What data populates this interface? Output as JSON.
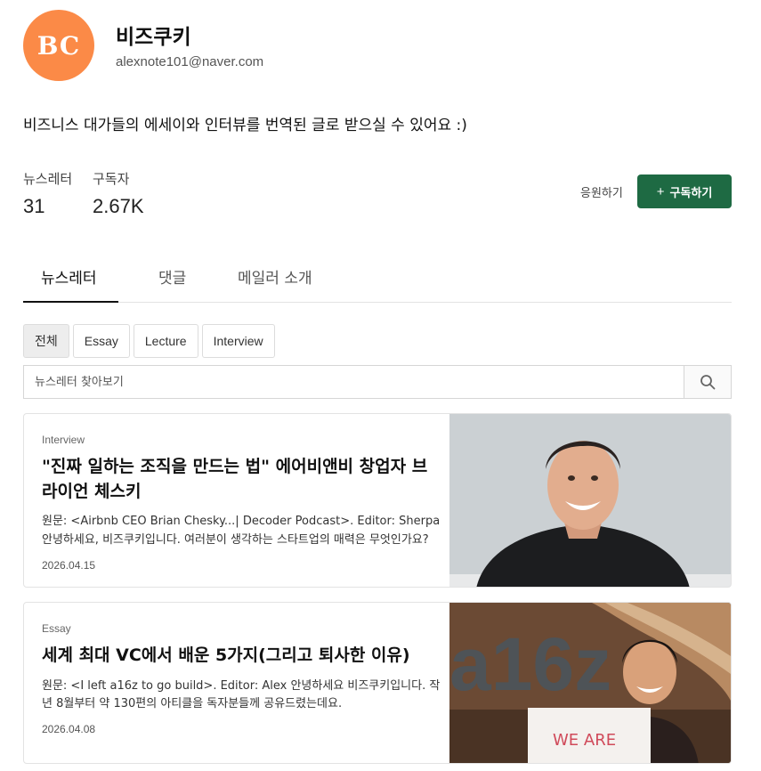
{
  "profile": {
    "avatar_text": "BC",
    "avatar_color": "#fb8a47",
    "name": "비즈쿠키",
    "email": "alexnote101@naver.com",
    "description": "비즈니스 대가들의 에세이와 인터뷰를 번역된 글로 받으실 수 있어요 :)"
  },
  "stats": {
    "newsletter_label": "뉴스레터",
    "newsletter_value": "31",
    "subscribers_label": "구독자",
    "subscribers_value": "2.67K"
  },
  "actions": {
    "support_label": "응원하기",
    "subscribe_icon": "+",
    "subscribe_label": "구독하기",
    "accent_color": "#1e6a43"
  },
  "tabs": [
    {
      "label": "뉴스레터",
      "active": true
    },
    {
      "label": "댓글",
      "active": false
    },
    {
      "label": "메일러 소개",
      "active": false
    }
  ],
  "filters": [
    {
      "label": "전체",
      "active": true
    },
    {
      "label": "Essay",
      "active": false
    },
    {
      "label": "Lecture",
      "active": false
    },
    {
      "label": "Interview",
      "active": false
    }
  ],
  "search": {
    "placeholder": "뉴스레터 찾아보기",
    "icon": "search-icon"
  },
  "posts": [
    {
      "category": "Interview",
      "title": "\"진짜 일하는 조직을 만드는 법\" 에어비앤비 창업자 브라이언 체스키",
      "excerpt": "원문: <Airbnb CEO Brian Chesky...| Decoder Podcast>. Editor: Sherpa 안녕하세요, 비즈쿠키입니다. 여러분이 생각하는 스타트업의 매력은 무엇인가요?",
      "date": "2026.04.15"
    },
    {
      "category": "Essay",
      "title": "세계 최대 VC에서 배운 5가지(그리고 퇴사한 이유)",
      "excerpt": "원문: <I left a16z to go build>. Editor: Alex 안녕하세요 비즈쿠키입니다. 작년 8월부터 약 130편의 아티클을 독자분들께 공유드렸는데요.",
      "date": "2026.04.08",
      "image_text": {
        "logo": "a16z",
        "sign": "WE ARE"
      }
    }
  ]
}
